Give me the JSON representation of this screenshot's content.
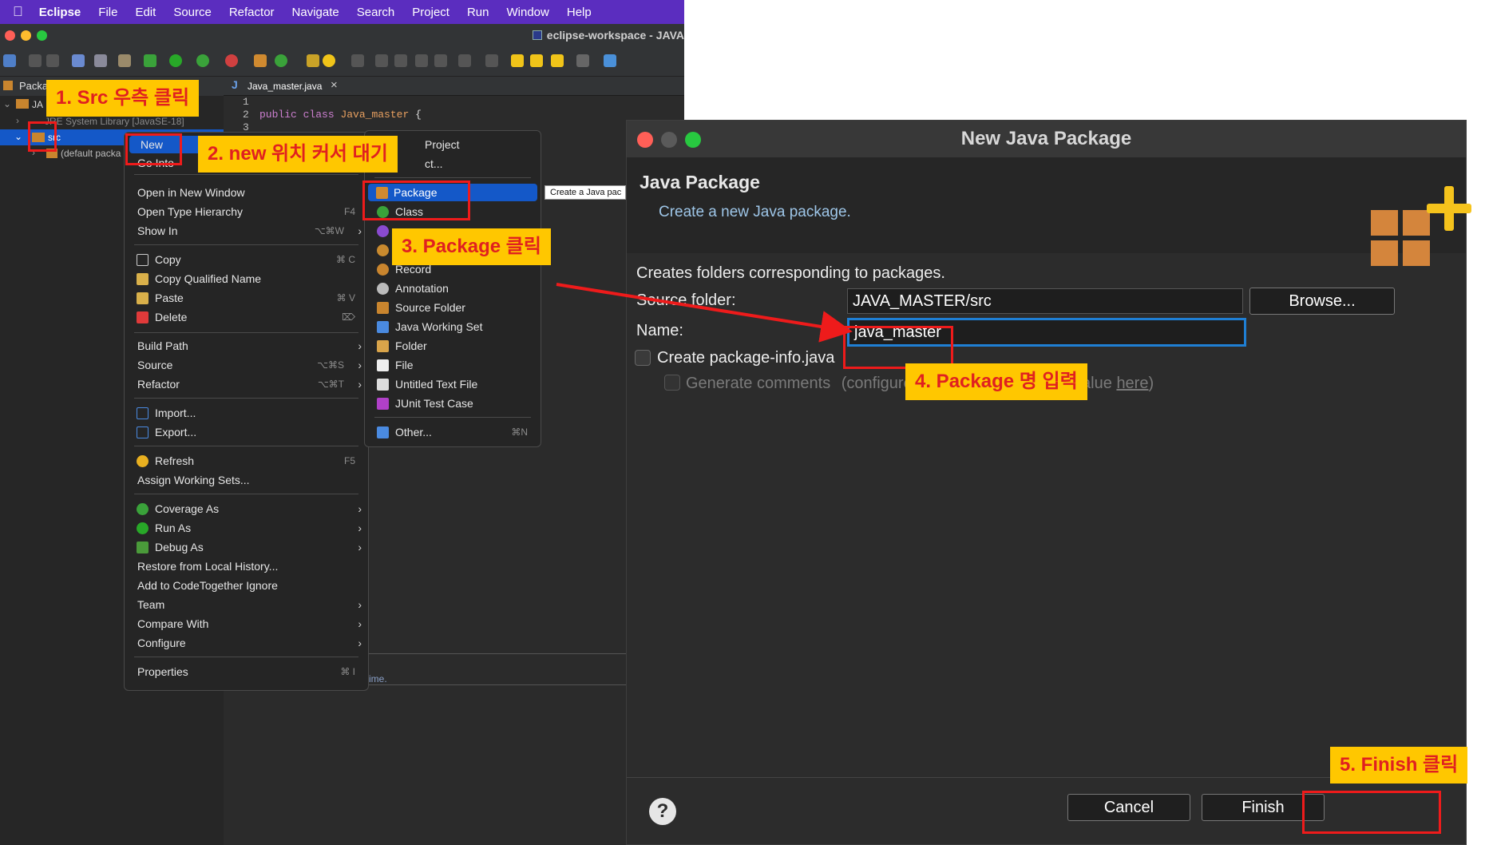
{
  "menubar": {
    "apple": "",
    "app": "Eclipse",
    "items": [
      "File",
      "Edit",
      "Source",
      "Refactor",
      "Navigate",
      "Search",
      "Project",
      "Run",
      "Window",
      "Help"
    ]
  },
  "window": {
    "title": "eclipse-workspace - JAVA"
  },
  "explorer": {
    "tab": "Packa",
    "project": "JA",
    "jre_label": "JRE System Library [JavaSE-18]",
    "src": "src",
    "default_pkg": "(default packa"
  },
  "editor": {
    "tab_icon": "J",
    "tab": "Java_master.java",
    "line_numbers": [
      "1",
      "2",
      "3"
    ],
    "code_kw1": "public class",
    "code_name": "Java_master",
    "code_rest": "{",
    "status_text": "ime."
  },
  "context_menu": {
    "new": "New",
    "go_into": "Go Into",
    "open_new_window": "Open in New Window",
    "open_type_hierarchy": "Open Type Hierarchy",
    "open_type_hierarchy_sc": "F4",
    "show_in": "Show In",
    "show_in_sc": "⌥⌘W",
    "copy": "Copy",
    "copy_sc": "⌘ C",
    "copy_qualified": "Copy Qualified Name",
    "paste": "Paste",
    "paste_sc": "⌘ V",
    "delete": "Delete",
    "delete_sc": "⌦",
    "build_path": "Build Path",
    "source": "Source",
    "source_sc": "⌥⌘S",
    "refactor": "Refactor",
    "refactor_sc": "⌥⌘T",
    "import": "Import...",
    "export": "Export...",
    "refresh": "Refresh",
    "refresh_sc": "F5",
    "assign_ws": "Assign Working Sets...",
    "coverage_as": "Coverage As",
    "run_as": "Run As",
    "debug_as": "Debug As",
    "restore": "Restore from Local History...",
    "add_codetogether": "Add to CodeTogether Ignore",
    "team": "Team",
    "compare_with": "Compare With",
    "configure": "Configure",
    "properties": "Properties",
    "properties_sc": "⌘ I"
  },
  "submenu": {
    "project": "Project",
    "project2": "ct...",
    "package": "Package",
    "class": "Class",
    "record": "Record",
    "annotation": "Annotation",
    "source_folder": "Source Folder",
    "java_working_set": "Java Working Set",
    "folder": "Folder",
    "file": "File",
    "untitled_text_file": "Untitled Text File",
    "junit_test_case": "JUnit Test Case",
    "other": "Other...",
    "other_sc": "⌘N"
  },
  "tooltip": "Create a Java pac",
  "dialog": {
    "title": "New Java Package",
    "heading": "Java Package",
    "subheading": "Create a new Java package.",
    "description": "Creates folders corresponding to packages.",
    "source_folder_label": "Source folder:",
    "source_folder_value": "JAVA_MASTER/src",
    "browse": "Browse...",
    "name_label": "Name:",
    "name_value": "java_master",
    "create_pkg_info": "Create package-info.java",
    "generate_comments": "Generate comments",
    "configure_note": "(configure templates and default value ",
    "here": "here",
    "configure_close": ")",
    "help": "?",
    "cancel": "Cancel",
    "finish": "Finish"
  },
  "annotations": {
    "step1": "1. Src 우측 클릭",
    "step2": "2. new 위치 커서 대기",
    "step3": "3. Package 클릭",
    "step4": "4.  Package 명 입력",
    "step5": "5. Finish 클릭"
  },
  "colors": {
    "menubar": "#5b2dbf",
    "selection": "#1458c8",
    "annotation_bg": "#ffc700",
    "annotation_text": "#e02020",
    "highlight_box": "#ee1b1b",
    "focus_ring": "#1f7fd4"
  }
}
